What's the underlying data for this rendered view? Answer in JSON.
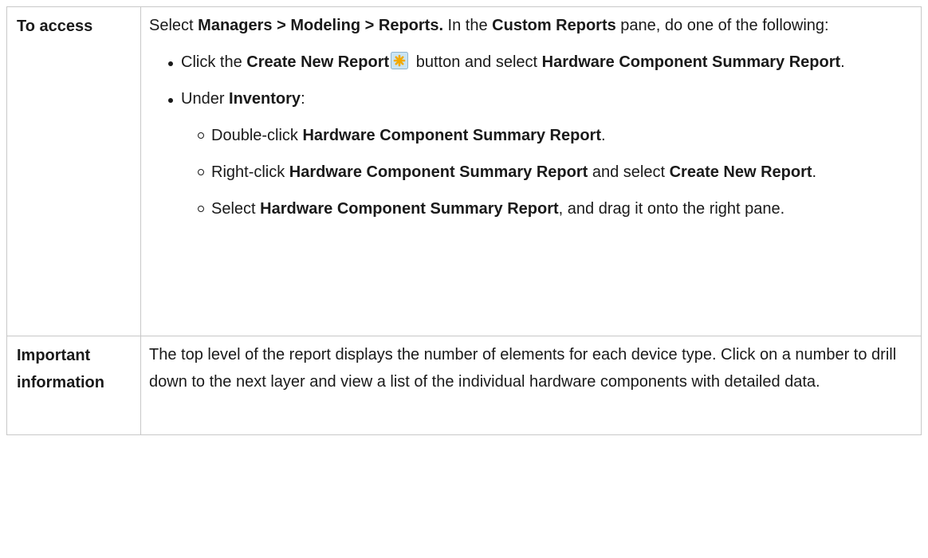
{
  "table": {
    "rows": [
      {
        "header": "To access",
        "intro": [
          {
            "t": "Select "
          },
          {
            "t": "Managers > Modeling > Reports.",
            "b": true
          },
          {
            "t": " In the "
          },
          {
            "t": "Custom Reports",
            "b": true
          },
          {
            "t": " pane, do one of the following:"
          }
        ],
        "bullets": [
          {
            "parts": [
              {
                "t": "Click the "
              },
              {
                "t": "Create New Report",
                "b": true
              },
              {
                "icon": "create-new-report-icon"
              },
              {
                "t": " button and select "
              },
              {
                "t": "Hardware Component Summary Report",
                "b": true
              },
              {
                "t": "."
              }
            ]
          },
          {
            "parts": [
              {
                "t": "Under "
              },
              {
                "t": "Inventory",
                "b": true
              },
              {
                "t": ":"
              }
            ],
            "sub": [
              [
                {
                  "t": "Double-click "
                },
                {
                  "t": "Hardware Component Summary Report",
                  "b": true
                },
                {
                  "t": "."
                }
              ],
              [
                {
                  "t": "Right-click "
                },
                {
                  "t": "Hardware Component Summary Report",
                  "b": true
                },
                {
                  "t": " and select "
                },
                {
                  "t": "Create New Report",
                  "b": true
                },
                {
                  "t": "."
                }
              ],
              [
                {
                  "t": "Select "
                },
                {
                  "t": "Hardware Component Summary Report",
                  "b": true
                },
                {
                  "t": ", and drag it onto the right pane."
                }
              ]
            ]
          }
        ]
      },
      {
        "header": "Important information",
        "text": "The top level of the report displays the number of elements for each device type. Click on a number to drill down to the next layer and view a list of the individual hardware components with detailed data."
      }
    ]
  },
  "colors": {
    "border": "#c8c8c8",
    "text": "#1a1a1a",
    "icon_bg": "#c9e4f5",
    "icon_star": "#f2a900"
  }
}
